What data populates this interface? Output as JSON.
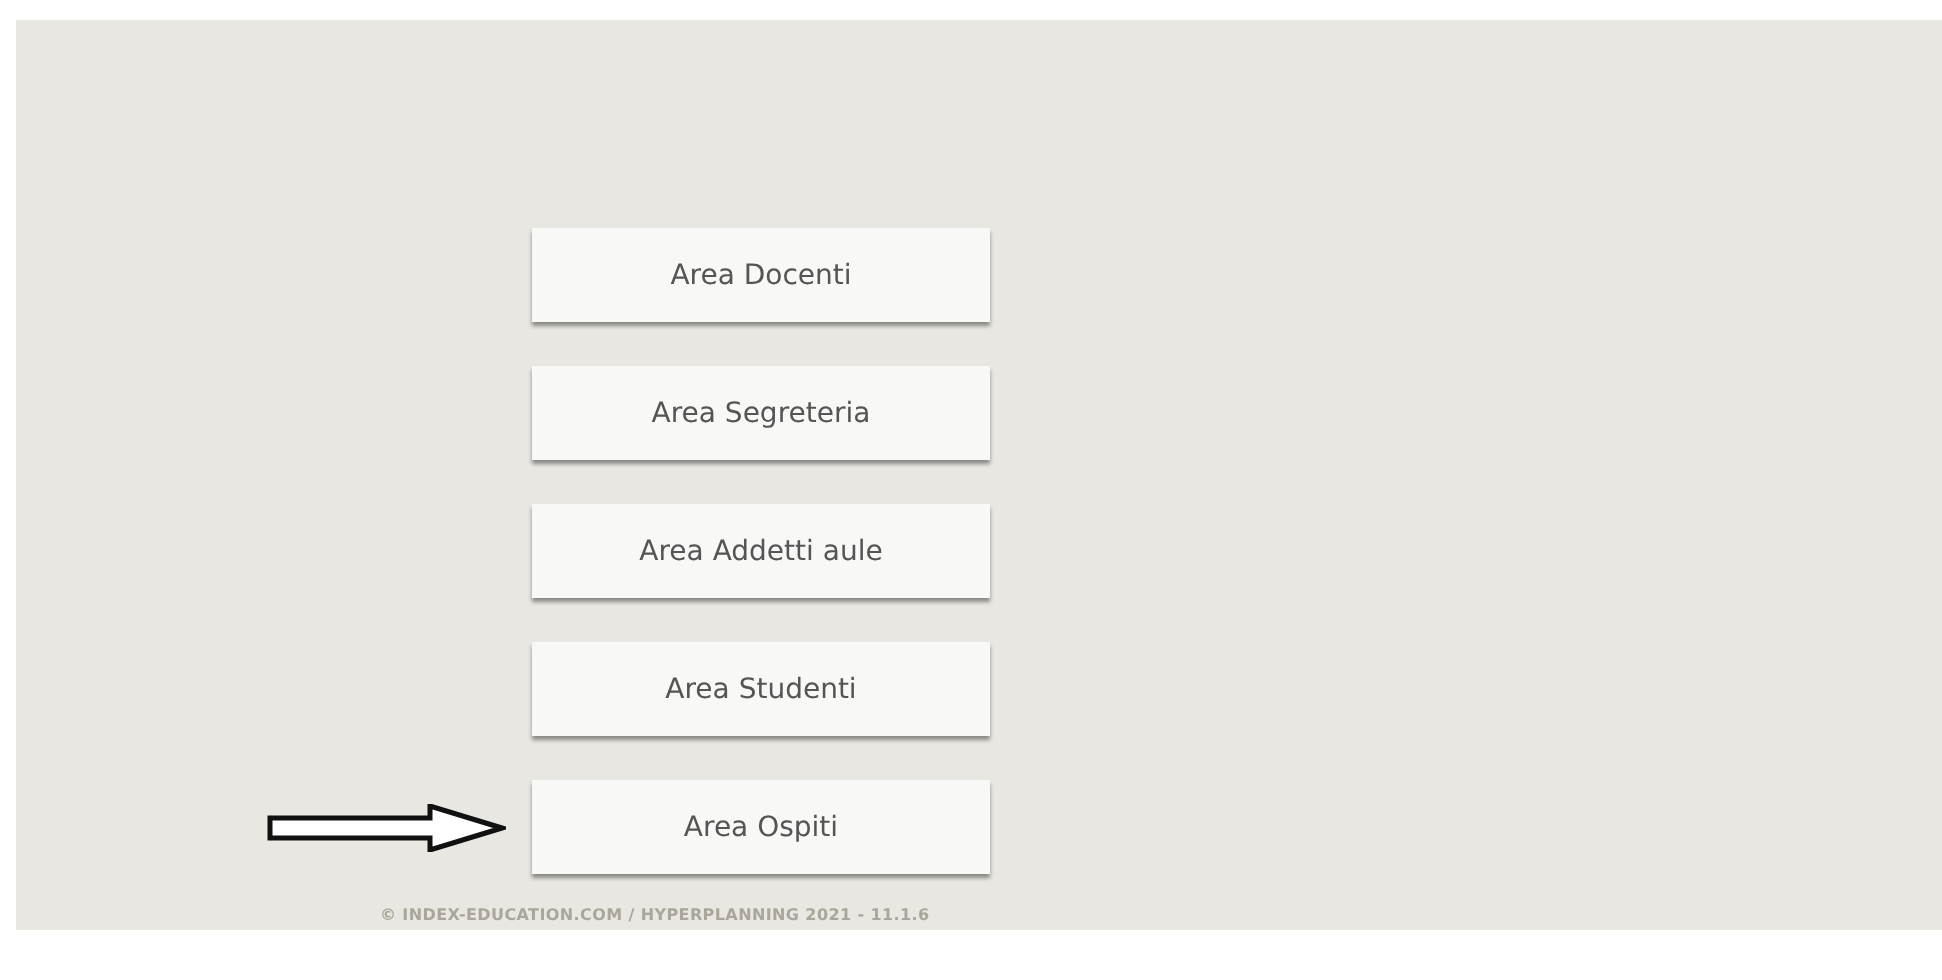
{
  "menu": [
    {
      "label": "Area Docenti",
      "pointed_at": false
    },
    {
      "label": "Area Segreteria",
      "pointed_at": false
    },
    {
      "label": "Area Addetti aule",
      "pointed_at": false
    },
    {
      "label": "Area Studenti",
      "pointed_at": false
    },
    {
      "label": "Area Ospiti",
      "pointed_at": true
    }
  ],
  "footer": "© INDEX-EDUCATION.COM / HYPERPLANNING 2021 - 11.1.6"
}
